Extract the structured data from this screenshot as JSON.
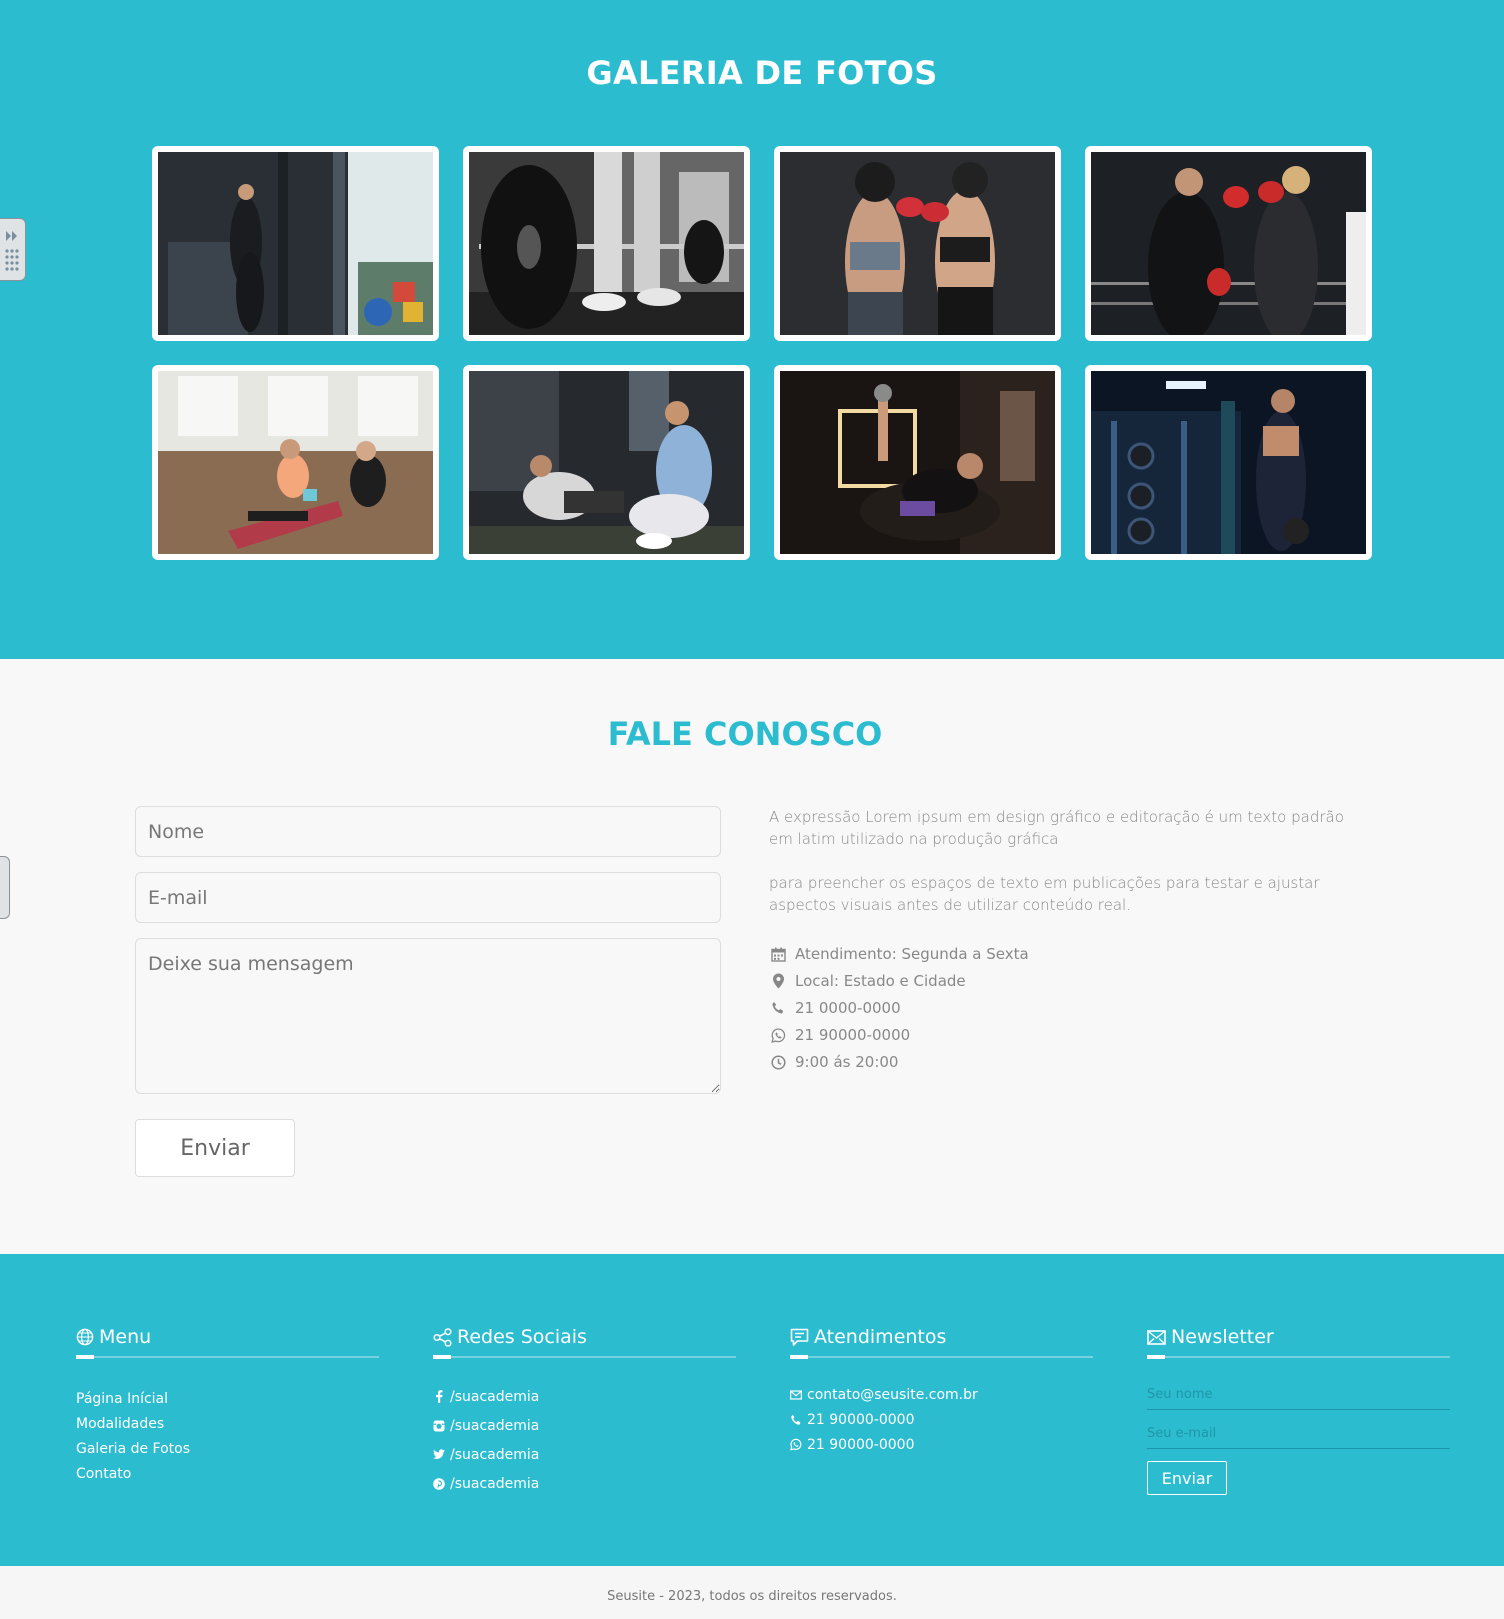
{
  "gallery": {
    "title": "GALERIA DE FOTOS",
    "photos": [
      "gym-woman-cable-machine",
      "barbell-lift-bw",
      "women-boxing-sparring",
      "man-woman-boxing-ring",
      "women-stretching-yoga-mat",
      "partner-situps-highfive",
      "woman-dumbbell-bench",
      "woman-kettlebell-gym"
    ]
  },
  "contact": {
    "title": "FALE CONOSCO",
    "name_placeholder": "Nome",
    "email_placeholder": "E-mail",
    "message_placeholder": "Deixe sua mensagem",
    "send_label": "Enviar",
    "paragraph1": "A expressão Lorem ipsum em design gráfico e editoração é um texto padrão em latim utilizado na produção gráfica",
    "paragraph2": "para preencher os espaços de texto em publicações para testar e ajustar aspectos visuais antes de utilizar conteúdo real.",
    "info": [
      {
        "icon": "calendar-icon",
        "text": "Atendimento: Segunda a Sexta"
      },
      {
        "icon": "map-pin-icon",
        "text": "Local: Estado e Cidade"
      },
      {
        "icon": "phone-icon",
        "text": "21 0000-0000"
      },
      {
        "icon": "whatsapp-icon",
        "text": "21 90000-0000"
      },
      {
        "icon": "clock-icon",
        "text": "9:00 ás 20:00"
      }
    ]
  },
  "footer": {
    "menu": {
      "title": "Menu",
      "items": [
        "Página Inícial",
        "Modalidades",
        "Galeria de Fotos",
        "Contato"
      ]
    },
    "social": {
      "title": "Redes Sociais",
      "items": [
        {
          "icon": "facebook-icon",
          "text": "/suacademia"
        },
        {
          "icon": "instagram-icon",
          "text": "/suacademia"
        },
        {
          "icon": "twitter-icon",
          "text": "/suacademia"
        },
        {
          "icon": "pinterest-icon",
          "text": "/suacademia"
        }
      ]
    },
    "service": {
      "title": "Atendimentos",
      "items": [
        {
          "icon": "envelope-icon",
          "text": "contato@seusite.com.br"
        },
        {
          "icon": "phone-icon",
          "text": "21 90000-0000"
        },
        {
          "icon": "whatsapp-icon",
          "text": "21 90000-0000"
        }
      ]
    },
    "newsletter": {
      "title": "Newsletter",
      "name_placeholder": "Seu nome",
      "email_placeholder": "Seu e-mail",
      "send_label": "Enviar"
    }
  },
  "copyright": "Seusite - 2023, todos os direitos reservados.",
  "colors": {
    "primary": "#2cbcd0",
    "background": "#f8f8f8",
    "text": "#888888"
  }
}
